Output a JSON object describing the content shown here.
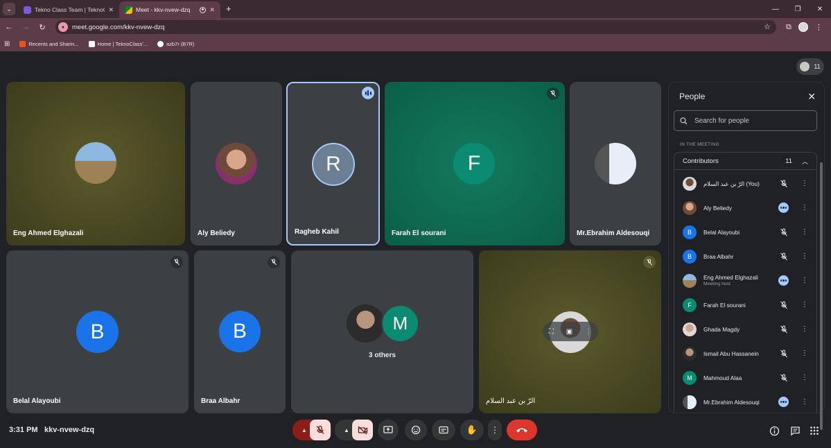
{
  "browser": {
    "tabs": [
      {
        "label": "Tekno Class Team | TeknoClass",
        "active": false
      },
      {
        "label": "Meet - kkv-nvew-dzq",
        "active": true
      }
    ],
    "url": "meet.google.com/kkv-nvew-dzq",
    "bookmarks": [
      "Recents and Sharin...",
      "Home | TeknoClass'...",
      "azb7r (B7R)"
    ]
  },
  "meeting": {
    "participant_count": "11",
    "time": "3:31 PM",
    "code": "kkv-nvew-dzq",
    "tiles": [
      {
        "name": "Eng Ahmed Elghazali",
        "kind": "photo"
      },
      {
        "name": "Aly Beliedy",
        "kind": "photo"
      },
      {
        "name": "Ragheb Kahil",
        "letter": "R",
        "speaking": true
      },
      {
        "name": "Farah El sourani",
        "letter": "F"
      },
      {
        "name": "Mr.Ebrahim Aldesouqi",
        "kind": "photo"
      },
      {
        "name": "Belal Alayoubi",
        "letter": "B"
      },
      {
        "name": "Braa Albahr",
        "letter": "B"
      },
      {
        "name": "3 others",
        "letter": "M"
      },
      {
        "name": "الرّ بن عبد السلام",
        "kind": "photo"
      }
    ]
  },
  "people_panel": {
    "title": "People",
    "search_placeholder": "Search for people",
    "section_label": "IN THE MEETING",
    "group_label": "Contributors",
    "group_count": "11",
    "people": [
      {
        "name": "الرّ بن عبد السلام (You)",
        "status": "muted",
        "avatar": "photo"
      },
      {
        "name": "Aly Beliedy",
        "status": "speaking",
        "avatar": "photo"
      },
      {
        "name": "Belal Alayoubi",
        "status": "muted",
        "avatar": "B",
        "color": "#1a73e8"
      },
      {
        "name": "Braa Albahr",
        "status": "muted",
        "avatar": "B",
        "color": "#1a73e8"
      },
      {
        "name": "Eng Ahmed Elghazali",
        "sub": "Meeting host",
        "status": "speaking",
        "avatar": "photo"
      },
      {
        "name": "Farah El sourani",
        "status": "muted",
        "avatar": "F",
        "color": "#0b8b72"
      },
      {
        "name": "Ghada Magdy",
        "status": "muted",
        "avatar": "photo"
      },
      {
        "name": "Ismail Abu Hassanein",
        "status": "muted",
        "avatar": "photo"
      },
      {
        "name": "Mahmoud Alaa",
        "status": "muted",
        "avatar": "M",
        "color": "#0b8b72"
      },
      {
        "name": "Mr.Ebrahim Aldesouqi",
        "status": "speaking",
        "avatar": "photo"
      }
    ]
  },
  "colors": {
    "accent_blue": "#a8c7fa",
    "hangup_red": "#dc362e",
    "teal": "#0b8b72",
    "avatar_blue": "#1a73e8"
  }
}
